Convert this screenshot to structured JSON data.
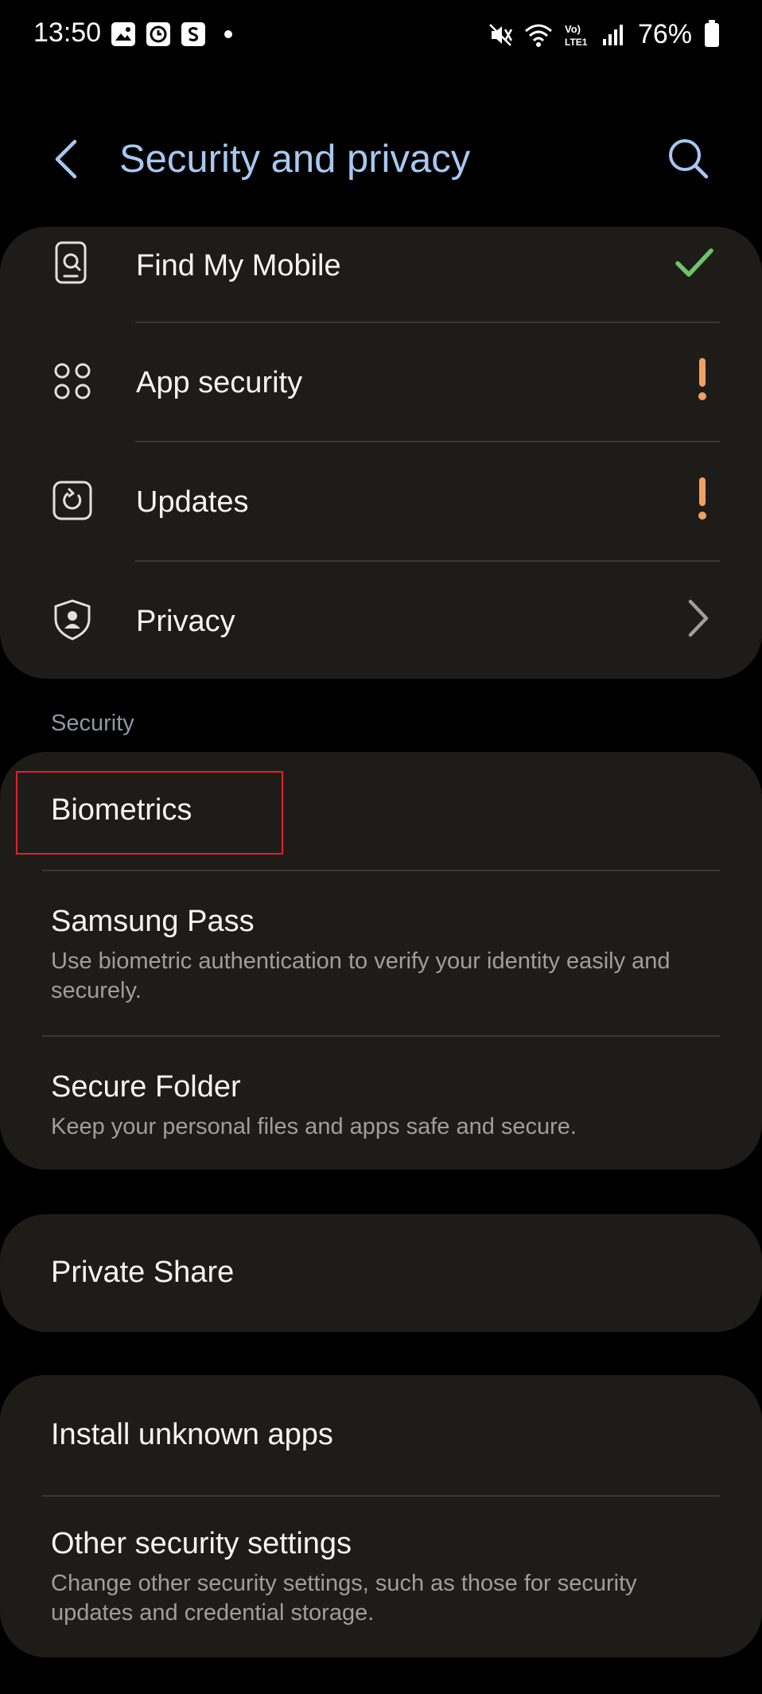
{
  "status_bar": {
    "time": "13:50",
    "battery_pct": "76%",
    "icons": [
      "gallery-icon",
      "clock-icon",
      "s-app-icon",
      "notification-dot",
      "mute-icon",
      "wifi-icon",
      "volte-icon",
      "signal-icon",
      "battery-icon"
    ],
    "volte_label": "Vo) LTE1"
  },
  "header": {
    "title": "Security and privacy",
    "back_icon": "back-arrow-icon",
    "search_icon": "search-icon"
  },
  "top_group": {
    "items": [
      {
        "label": "Find My Mobile",
        "icon": "find-my-mobile-icon",
        "status": "ok",
        "status_color": "#6cc56c"
      },
      {
        "label": "App security",
        "icon": "app-security-icon",
        "status": "warning",
        "status_color": "#f0a060"
      },
      {
        "label": "Updates",
        "icon": "updates-icon",
        "status": "warning",
        "status_color": "#f0a060"
      },
      {
        "label": "Privacy",
        "icon": "privacy-shield-icon",
        "status": "chevron"
      }
    ]
  },
  "security_section": {
    "label": "Security",
    "items": [
      {
        "title": "Biometrics"
      },
      {
        "title": "Samsung Pass",
        "subtitle": "Use biometric authentication to verify your identity easily and securely."
      },
      {
        "title": "Secure Folder",
        "subtitle": "Keep your personal files and apps safe and secure."
      }
    ]
  },
  "private_share": {
    "title": "Private Share"
  },
  "more_group": {
    "items": [
      {
        "title": "Install unknown apps"
      },
      {
        "title": "Other security settings",
        "subtitle": "Change other security settings, such as those for security updates and credential storage."
      }
    ]
  },
  "colors": {
    "background": "#000000",
    "card": "#1e1c19",
    "title_accent": "#a7c8f0",
    "ok": "#6cc56c",
    "warning": "#f0a060",
    "highlight": "#e2202a"
  }
}
